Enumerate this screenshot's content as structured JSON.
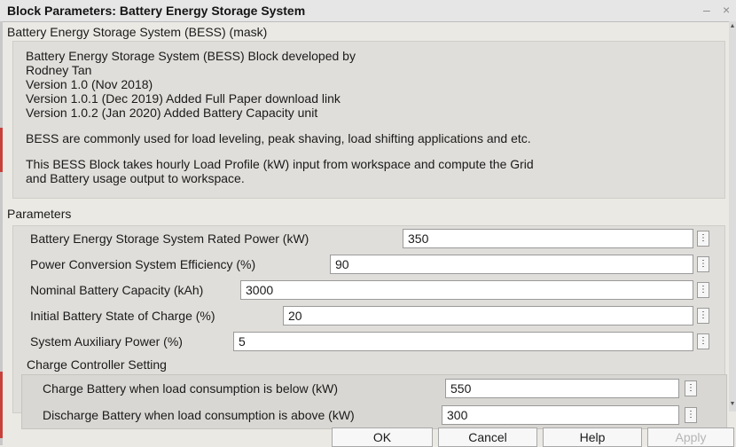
{
  "window": {
    "title": "Block Parameters: Battery Energy Storage System",
    "minimize": "–",
    "close": "×"
  },
  "mask": {
    "heading": "Battery Energy Storage System (BESS) (mask)",
    "description": [
      "Battery Energy Storage System (BESS) Block developed by",
      "Rodney Tan",
      "Version 1.0 (Nov 2018)",
      "Version 1.0.1 (Dec 2019) Added Full Paper download link",
      "Version 1.0.2 (Jan 2020) Added Battery Capacity unit",
      "BESS are commonly used for load leveling, peak shaving, load shifting applications and etc.",
      "This BESS Block takes hourly Load Profile (kW) input from workspace and compute the Grid",
      "and Battery usage output to workspace."
    ]
  },
  "parameters": {
    "heading": "Parameters",
    "fields": [
      {
        "label": "Battery Energy Storage System Rated Power (kW)",
        "value": "350"
      },
      {
        "label": "Power Conversion System Efficiency (%)",
        "value": "90"
      },
      {
        "label": "Nominal Battery Capacity (kAh)",
        "value": "3000"
      },
      {
        "label": "Initial Battery State of Charge (%)",
        "value": "20"
      },
      {
        "label": "System Auxiliary Power (%)",
        "value": "5"
      }
    ],
    "charge_controller": {
      "heading": "Charge Controller Setting",
      "fields": [
        {
          "label": "Charge Battery when load consumption is below (kW)",
          "value": "550"
        },
        {
          "label": "Discharge Battery when load consumption is above (kW)",
          "value": "300"
        }
      ]
    },
    "menu_glyph": "⋮"
  },
  "buttons": {
    "ok": "OK",
    "cancel": "Cancel",
    "help": "Help",
    "apply": "Apply"
  }
}
